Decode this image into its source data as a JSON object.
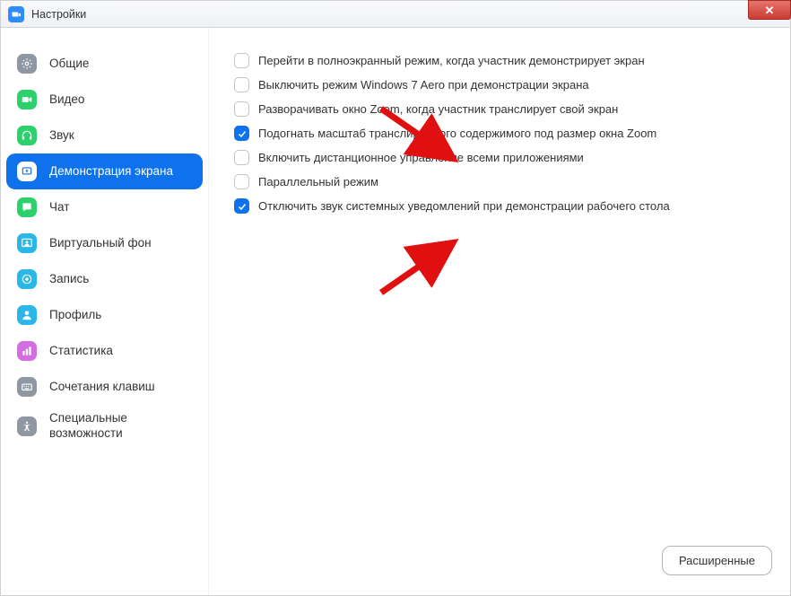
{
  "window": {
    "title": "Настройки"
  },
  "sidebar": {
    "items": [
      {
        "label": "Общие",
        "icon": "gear",
        "color": "#8f97a3"
      },
      {
        "label": "Видео",
        "icon": "video",
        "color": "#2dd16c"
      },
      {
        "label": "Звук",
        "icon": "headphones",
        "color": "#2dd16c"
      },
      {
        "label": "Демонстрация экрана",
        "icon": "share",
        "color": "#ffffff",
        "active": true
      },
      {
        "label": "Чат",
        "icon": "chat",
        "color": "#2dd16c"
      },
      {
        "label": "Виртуальный фон",
        "icon": "virtualbg",
        "color": "#2ab6e6"
      },
      {
        "label": "Запись",
        "icon": "record",
        "color": "#2ab6e6"
      },
      {
        "label": "Профиль",
        "icon": "profile",
        "color": "#2ab6e6"
      },
      {
        "label": "Статистика",
        "icon": "stats",
        "color": "#d56de2"
      },
      {
        "label": "Сочетания клавиш",
        "icon": "keyboard",
        "color": "#8f97a3"
      },
      {
        "label": "Специальные возможности",
        "icon": "accessibility",
        "color": "#8f97a3"
      }
    ]
  },
  "options": [
    {
      "label": "Перейти в полноэкранный режим, когда участник демонстрирует экран",
      "checked": false
    },
    {
      "label": "Выключить режим Windows 7 Aero при демонстрации экрана",
      "checked": false
    },
    {
      "label": "Разворачивать окно Zoom, когда участник транслирует свой экран",
      "checked": false
    },
    {
      "label": "Подогнать масштаб транслируемого содержимого под размер окна Zoom",
      "checked": true
    },
    {
      "label": "Включить дистанционное управление всеми приложениями",
      "checked": false
    },
    {
      "label": "Параллельный режим",
      "checked": false
    },
    {
      "label": "Отключить звук системных уведомлений при демонстрации рабочего стола",
      "checked": true
    }
  ],
  "advanced_button": "Расширенные"
}
